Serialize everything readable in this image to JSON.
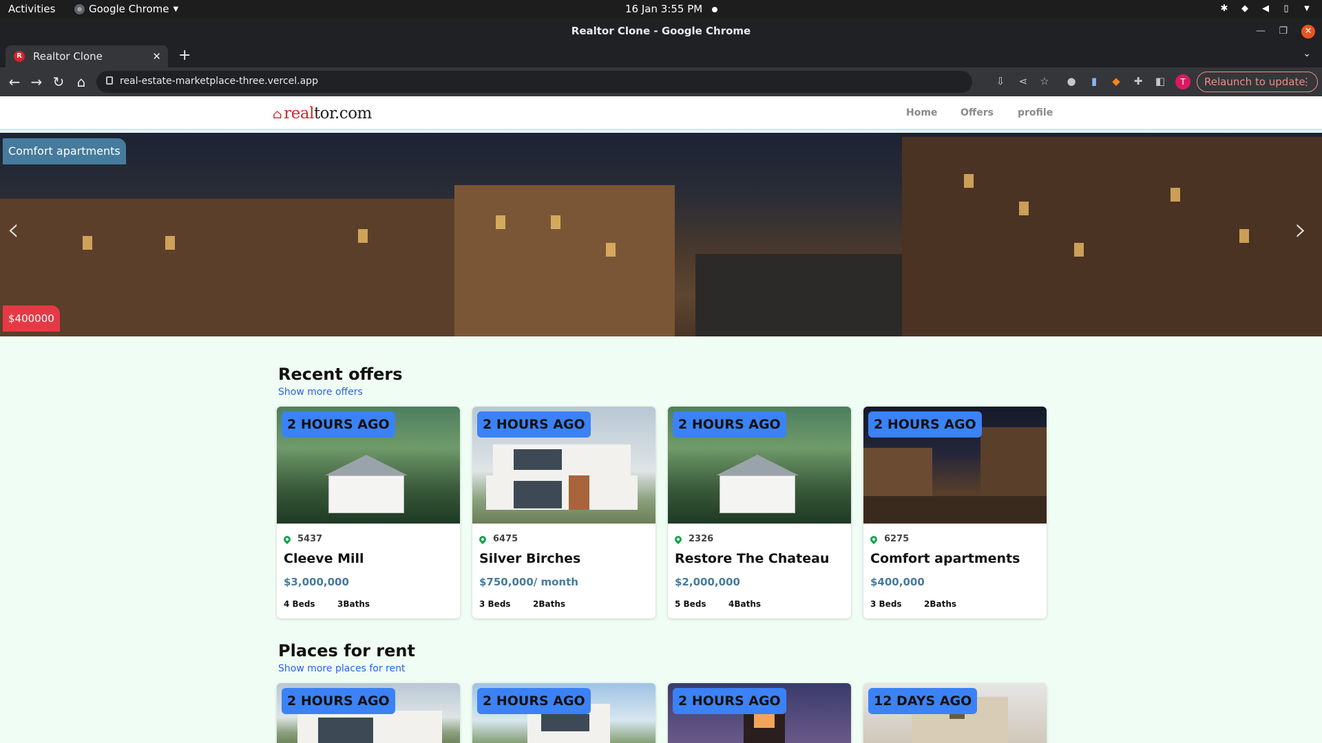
{
  "os": {
    "activities": "Activities",
    "app_name": "Google Chrome",
    "clock": "16 Jan  3:55 PM"
  },
  "window": {
    "title": "Realtor Clone - Google Chrome"
  },
  "tab": {
    "title": "Realtor Clone",
    "favicon_letter": "R"
  },
  "toolbar": {
    "url": "real-estate-marketplace-three.vercel.app",
    "profile_letter": "T",
    "relaunch_label": "Relaunch to update"
  },
  "site": {
    "logo_red": "real",
    "logo_dark": "tor.com",
    "nav": [
      "Home",
      "Offers",
      "profile"
    ]
  },
  "hero": {
    "title": "Comfort apartments",
    "price": "$400000"
  },
  "recent": {
    "title": "Recent offers",
    "link": "Show more offers",
    "cards": [
      {
        "badge": "2 HOURS AGO",
        "location": "5437",
        "name": "Cleeve Mill",
        "price": "$3,000,000",
        "beds": "4 Beds",
        "baths": "3Baths"
      },
      {
        "badge": "2 HOURS AGO",
        "location": "6475",
        "name": "Silver Birches",
        "price": "$750,000/ month",
        "beds": "3 Beds",
        "baths": "2Baths"
      },
      {
        "badge": "2 HOURS AGO",
        "location": "2326",
        "name": "Restore The Chateau",
        "price": "$2,000,000",
        "beds": "5 Beds",
        "baths": "4Baths"
      },
      {
        "badge": "2 HOURS AGO",
        "location": "6275",
        "name": "Comfort apartments",
        "price": "$400,000",
        "beds": "3 Beds",
        "baths": "2Baths"
      }
    ]
  },
  "rent": {
    "title": "Places for rent",
    "link": "Show more places for rent",
    "cards": [
      {
        "badge": "2 HOURS AGO"
      },
      {
        "badge": "2 HOURS AGO"
      },
      {
        "badge": "2 HOURS AGO"
      },
      {
        "badge": "12 DAYS AGO"
      }
    ]
  },
  "colors": {
    "brand_red": "#d92228",
    "badge_blue": "#3b82f6",
    "price_blue": "#457b9d",
    "page_bg": "#f0fdf4",
    "hero_price_red": "#e63946"
  }
}
